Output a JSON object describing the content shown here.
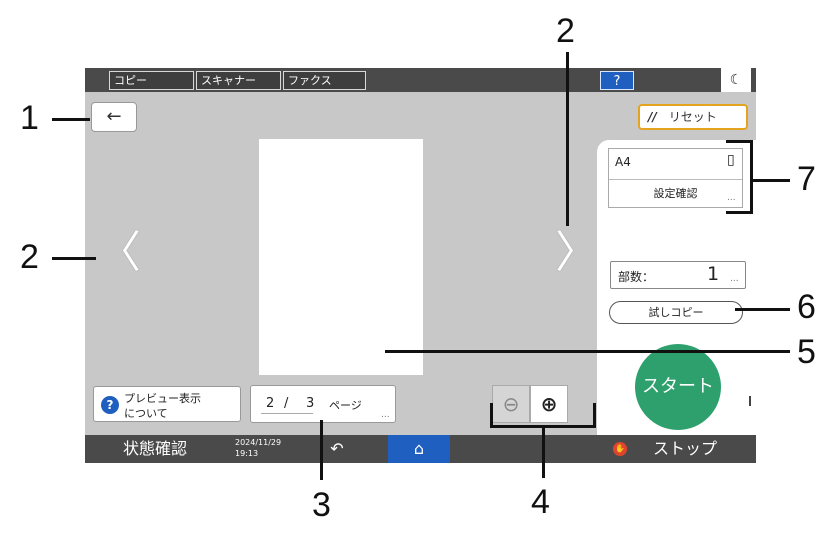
{
  "topbar": {
    "tabs": [
      "コピー",
      "スキャナー",
      "ファクス"
    ],
    "help": "?",
    "moon_icon": "moon-icon"
  },
  "back": {
    "glyph": "←"
  },
  "nav": {
    "prev": "〈",
    "next": "〉"
  },
  "reset": {
    "glyph": "//",
    "label": "リセット"
  },
  "paper": {
    "size": "A4",
    "icon": "portrait-page-icon",
    "settings_label": "設定確認"
  },
  "copies": {
    "label": "部数：",
    "value": "1"
  },
  "trial_copy": "試しコピー",
  "start": "スタート",
  "preview_help": {
    "line1": "プレビュー表示",
    "line2": "について"
  },
  "page_indicator": {
    "current": "2",
    "sep": "/",
    "total": "3",
    "unit": "ページ"
  },
  "zoom": {
    "out": "⊖",
    "in": "⊕"
  },
  "bottombar": {
    "status": "状態確認",
    "date": "2024/11/29",
    "time": "19:13",
    "back": "↶",
    "home": "⌂",
    "stop_icon": "✋",
    "stop": "ストップ"
  },
  "dots": "...",
  "callouts": [
    "1",
    "2",
    "2",
    "3",
    "4",
    "5",
    "6",
    "7"
  ],
  "colors": {
    "accent_blue": "#1f5fbf",
    "start_green": "#2ea06d",
    "reset_orange": "#e5a41f",
    "stop_red": "#e0452c"
  }
}
